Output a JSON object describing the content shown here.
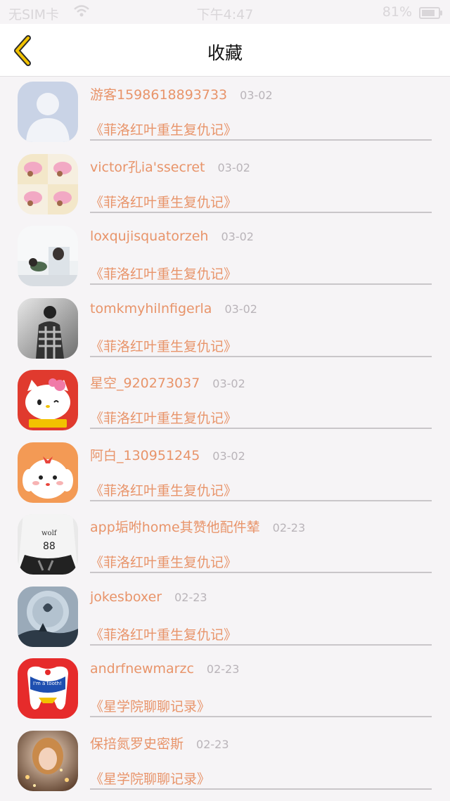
{
  "status_bar": {
    "carrier": "无SIM卡",
    "time": "下午4:47",
    "battery": "81%"
  },
  "nav": {
    "title": "收藏",
    "back_icon": "chevron-left-icon",
    "accent_color": "#f2c200"
  },
  "items": [
    {
      "name": "游客1598618893733",
      "date": "03-02",
      "book": "《菲洛红叶重生复仇记》",
      "avatar": "default-user"
    },
    {
      "name": "victor孔ia'ssecret",
      "date": "03-02",
      "book": "《菲洛红叶重生复仇记》",
      "avatar": "pink-cartoon"
    },
    {
      "name": "loxqujisquatorzeh",
      "date": "03-02",
      "book": "《菲洛红叶重生复仇记》",
      "avatar": "couple-photo"
    },
    {
      "name": "tomkmyhilnfigerla",
      "date": "03-02",
      "book": "《菲洛红叶重生复仇记》",
      "avatar": "bw-person"
    },
    {
      "name": "星空_920273037",
      "date": "03-02",
      "book": "《菲洛红叶重生复仇记》",
      "avatar": "hello-kitty"
    },
    {
      "name": "阿白_130951245",
      "date": "03-02",
      "book": "《菲洛红叶重生复仇记》",
      "avatar": "white-dog"
    },
    {
      "name": "app垢咐home其赞他配件辇",
      "date": "02-23",
      "book": "《菲洛红叶重生复仇记》",
      "avatar": "wolf-88"
    },
    {
      "name": "jokesboxer",
      "date": "02-23",
      "book": "《菲洛红叶重生复仇记》",
      "avatar": "whale-art"
    },
    {
      "name": "andrfnewmarzc",
      "date": "02-23",
      "book": "《星学院聊聊记录》",
      "avatar": "tooth-cartoon"
    },
    {
      "name": "保掊氮罗史密斯",
      "date": "02-23",
      "book": "《星学院聊聊记录》",
      "avatar": "girl-lights"
    }
  ]
}
